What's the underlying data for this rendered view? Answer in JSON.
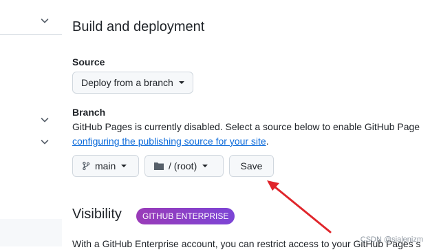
{
  "sidebar": {
    "icons": [
      "chevron-down-icon",
      "chevron-down-icon",
      "chevron-down-icon"
    ]
  },
  "build": {
    "title": "Build and deployment",
    "source_label": "Source",
    "source_value": "Deploy from a branch",
    "branch_label": "Branch",
    "description": "GitHub Pages is currently disabled. Select a source below to enable GitHub Page",
    "link_text": "configuring the publishing source for your site",
    "link_suffix": ".",
    "branch_button": "main",
    "folder_button": "/ (root)",
    "save_button": "Save"
  },
  "visibility": {
    "title": "Visibility",
    "badge": "GITHUB ENTERPRISE",
    "description": "With a GitHub Enterprise account, you can restrict access to your GitHub Pages s"
  },
  "credit": "CSDN @sialenizm",
  "colors": {
    "link": "#0969da",
    "badge_start": "#9a3bb8",
    "badge_end": "#7c45d6",
    "annotation_arrow": "#e0252b"
  }
}
